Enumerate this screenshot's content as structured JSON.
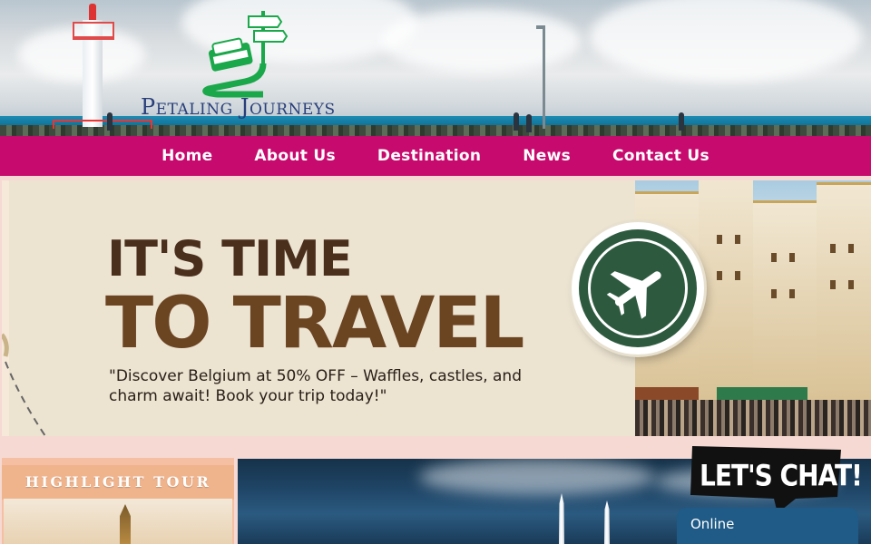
{
  "brand": {
    "name": "Petaling Journeys",
    "primary": "#c70a6e",
    "logo_green": "#1aa84a"
  },
  "nav": {
    "items": [
      "Home",
      "About Us",
      "Destination",
      "News",
      "Contact Us"
    ]
  },
  "hero": {
    "title_line1": "IT'S TIME",
    "title_line2": "TO TRAVEL",
    "subtitle": "\"Discover Belgium at 50% OFF – Waffles, castles, and charm await! Book your trip today!\"",
    "badge_icon": "airplane-icon"
  },
  "highlight": {
    "label": "HIGHLIGHT TOUR"
  },
  "chat": {
    "label": "LET'S CHAT!",
    "status": "Online"
  }
}
